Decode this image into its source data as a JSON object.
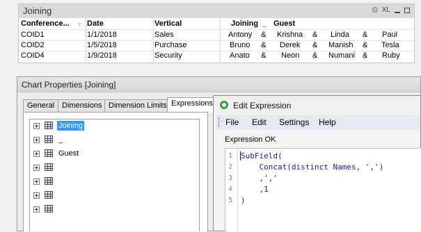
{
  "table_box": {
    "title": "Joining",
    "icons": {
      "print": "print-icon",
      "xl": "XL",
      "minimize": "minimize-icon",
      "maximize": "maximize-icon"
    },
    "columns": [
      "Conference...",
      "Date",
      "Vertical",
      "Joining",
      "_",
      "Guest"
    ],
    "rows": [
      {
        "conf": "COID1",
        "date": "1/1/2018",
        "vertical": "Sales",
        "names": [
          "Antony",
          "&",
          "Krishna",
          "&",
          "Linda",
          "&",
          "Paul"
        ]
      },
      {
        "conf": "COID2",
        "date": "1/5/2018",
        "vertical": "Purchase",
        "names": [
          "Bruno",
          "&",
          "Derek",
          "&",
          "Manish",
          "&",
          "Tesla"
        ]
      },
      {
        "conf": "COID4",
        "date": "1/9/2018",
        "vertical": "Security",
        "names": [
          "Anato",
          "&",
          "Neon",
          "&",
          "Numani",
          "&",
          "Ruby"
        ]
      }
    ]
  },
  "chart_properties": {
    "title": "Chart Properties [Joining]",
    "tabs": [
      "General",
      "Dimensions",
      "Dimension Limits",
      "Expressions"
    ],
    "active_tab": "Expressions",
    "tree_items": [
      "Joining",
      "_",
      "Guest",
      "",
      "",
      "",
      ""
    ]
  },
  "edit_expression": {
    "title": "Edit Expression",
    "menu": [
      "File",
      "Edit",
      "Settings",
      "Help"
    ],
    "status": "Expression OK",
    "line_numbers": [
      "1",
      "2",
      "3",
      "4",
      "5"
    ],
    "code_lines": [
      "SubField(",
      "    Concat(distinct Names, ',')",
      "    ,','",
      "    ,1",
      ")"
    ]
  },
  "colors": {
    "selection": "#3399ff",
    "code_text": "#1a1a8c",
    "title_bar": "#d9d9d9",
    "menu_bar": "#e5e9f2"
  }
}
